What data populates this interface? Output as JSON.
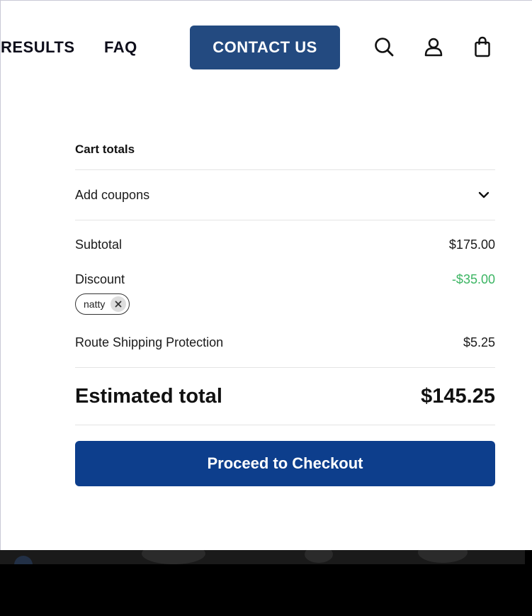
{
  "header": {
    "nav_results": "RESULTS",
    "nav_faq": "FAQ",
    "contact_label": "CONTACT US",
    "icons": [
      "search-icon",
      "account-icon",
      "shopping-bag-icon"
    ],
    "accent_color": "#234a80"
  },
  "cart_totals": {
    "title": "Cart totals",
    "coupons_label": "Add coupons",
    "subtotal_label": "Subtotal",
    "subtotal_value": "$175.00",
    "discount_label": "Discount",
    "discount_value": "-$35.00",
    "discount_color": "#3cb563",
    "coupon_code": "natty",
    "shipping_label": "Route Shipping Protection",
    "shipping_value": "$5.25",
    "estimated_label": "Estimated total",
    "estimated_value": "$145.25",
    "checkout_label": "Proceed to Checkout",
    "checkout_color": "#0d3e8c"
  }
}
